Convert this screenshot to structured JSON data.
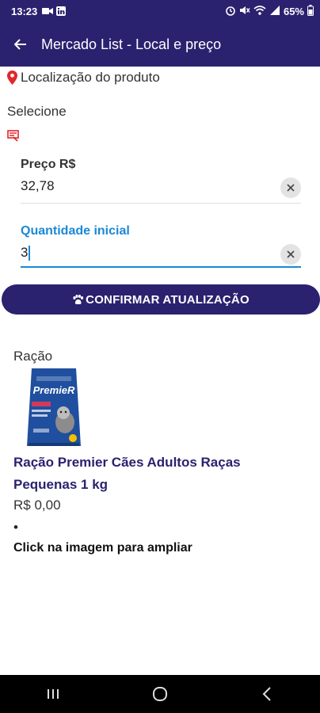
{
  "status": {
    "time": "13:23",
    "battery": "65%"
  },
  "appbar": {
    "title": "Mercado List - Local e preço"
  },
  "location": {
    "label": "Localização do produto"
  },
  "select_label": "Selecione",
  "price_field": {
    "label": "Preço R$",
    "value": "32,78"
  },
  "quantity_field": {
    "label": "Quantidade inicial",
    "value": "3",
    "accent": "#1a88d6"
  },
  "confirm_button": {
    "label": "CONFIRMAR ATUALIZAÇÃO"
  },
  "product": {
    "category": "Ração",
    "name": "Ração Premier Cães Adultos Raças Pequenas 1 kg",
    "price": "R$ 0,00",
    "bullet": "•",
    "hint": "Click na imagem para ampliar",
    "image_brand_text": "PremieR"
  },
  "colors": {
    "primary": "#2a226f",
    "pin": "#e3262b",
    "package": "#1f4f9e"
  }
}
